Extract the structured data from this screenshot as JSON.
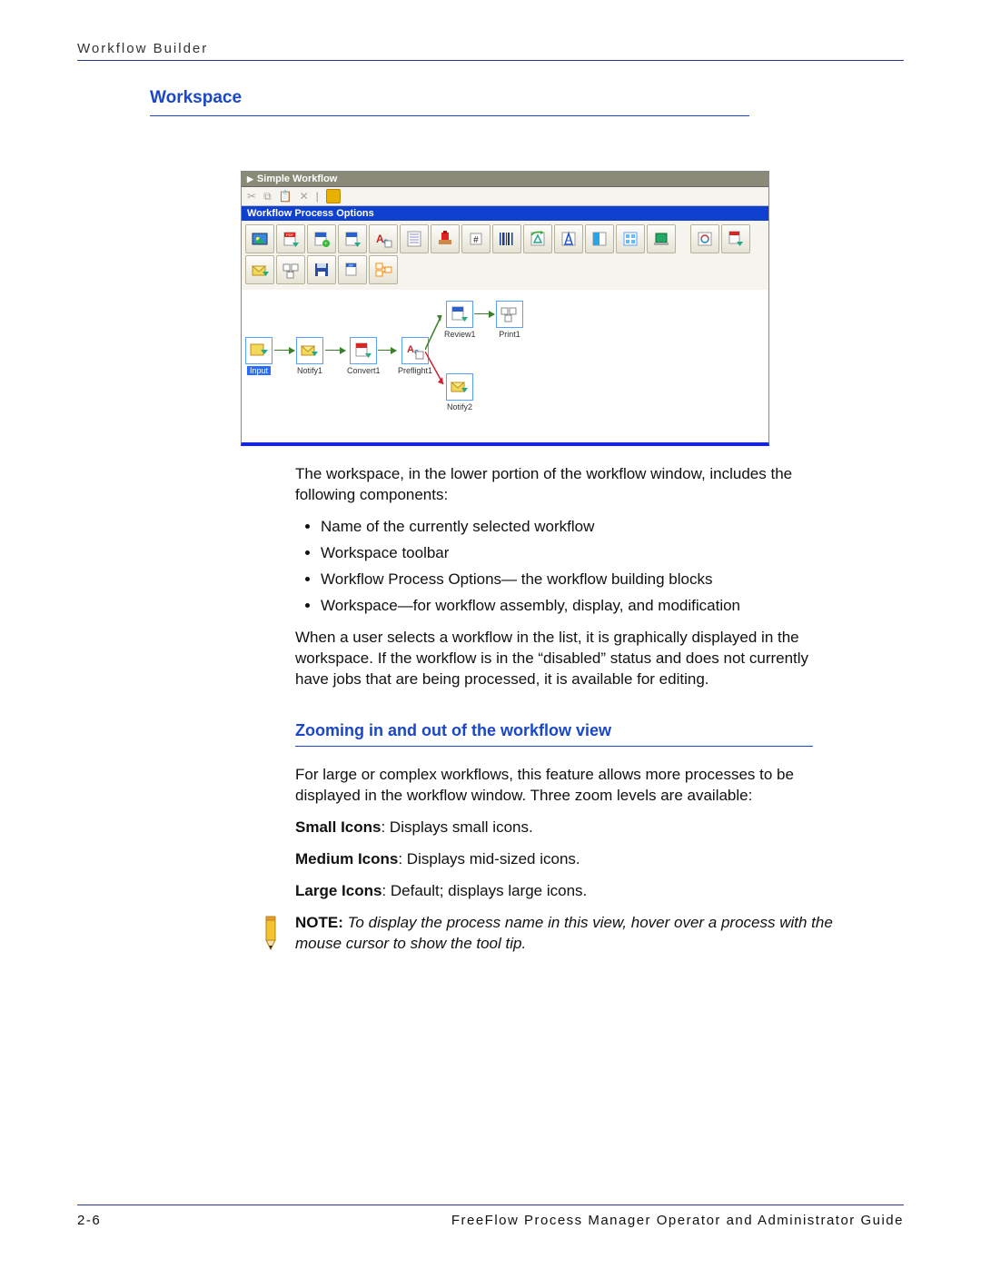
{
  "header": {
    "title": "Workflow Builder"
  },
  "h2a": "Workspace",
  "shot": {
    "title": "Simple Workflow",
    "section": "Workflow Process Options",
    "nodes": {
      "input": "Input",
      "notify1": "Notify1",
      "convert1": "Convert1",
      "preflight1": "Preflight1",
      "review1": "Review1",
      "print1": "Print1",
      "notify2": "Notify2"
    }
  },
  "para1": "The workspace, in the lower portion of the workflow window, includes the following components:",
  "bullets": [
    "Name of the currently selected workflow",
    "Workspace toolbar",
    "Workflow Process Options— the workflow building blocks",
    "Workspace—for workflow assembly, display, and modification"
  ],
  "para2": "When a user selects a workflow in the list, it is graphically displayed in the workspace. If the workflow is in the “disabled” status and does not currently have jobs that are being processed, it is available for editing.",
  "h3a": "Zooming in and out of the workflow view",
  "para3": "For large or complex workflows, this feature allows more processes to be displayed in the workflow window. Three zoom levels are available:",
  "zoom": {
    "small_b": "Small Icons",
    "small_t": ": Displays small icons.",
    "med_b": "Medium Icons",
    "med_t": ": Displays mid-sized icons.",
    "large_b": "Large Icons",
    "large_t": ": Default; displays large icons."
  },
  "note": {
    "b": "NOTE: ",
    "i": "To display the process name in this view, hover over a process with the mouse cursor to show the tool tip."
  },
  "footer": {
    "page": "2-6",
    "book": "FreeFlow Process Manager Operator and Administrator Guide"
  }
}
